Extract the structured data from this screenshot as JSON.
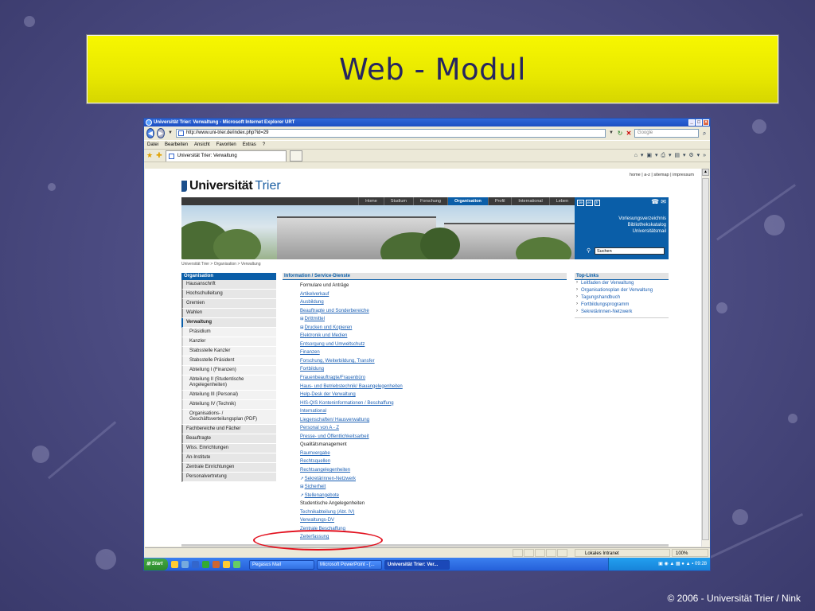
{
  "slide": {
    "title": "Web - Modul",
    "footer": "© 2006 - Universität Trier / Nink"
  },
  "window": {
    "title": "Universität Trier: Verwaltung - Microsoft Internet Explorer URT",
    "address": "http://www.uni-trier.de/index.php?id=29",
    "search_placeholder": "Google",
    "menu": [
      "Datei",
      "Bearbeiten",
      "Ansicht",
      "Favoriten",
      "Extras",
      "?"
    ],
    "tab_title": "Universität Trier: Verwaltung",
    "status_zone": "Lokales Intranet",
    "zoom": "100%"
  },
  "page": {
    "top_links": "home | a-z | sitemap | impressum",
    "logo_bold": "Universität",
    "logo_light": "Trier",
    "nav": [
      "Home",
      "Studium",
      "Forschung",
      "Organisation",
      "Profil",
      "International",
      "Leben"
    ],
    "nav_active": "Organisation",
    "lang": [
      "de",
      "en",
      "fr"
    ],
    "blue_links": [
      "Vorlesungsverzeichnis",
      "Bibliothekskatalog",
      "Universitätsmail"
    ],
    "search_value": "Suchen",
    "breadcrumb": "Universität Trier > Organisation > Verwaltung",
    "left_header": "Organisation",
    "left_nav": [
      {
        "label": "Hausanschrift",
        "kind": "top"
      },
      {
        "label": "Hochschulleitung",
        "kind": "top"
      },
      {
        "label": "Gremien",
        "kind": "top"
      },
      {
        "label": "Wahlen",
        "kind": "top"
      },
      {
        "label": "Verwaltung",
        "kind": "bold"
      },
      {
        "label": "Präsidium",
        "kind": "sub"
      },
      {
        "label": "Kanzler",
        "kind": "sub"
      },
      {
        "label": "Stabsstelle Kanzler",
        "kind": "sub"
      },
      {
        "label": "Stabsstelle Präsident",
        "kind": "sub"
      },
      {
        "label": "Abteilung I (Finanzen)",
        "kind": "sub"
      },
      {
        "label": "Abteilung II (Studentische Angelegenheiten)",
        "kind": "sub"
      },
      {
        "label": "Abteilung III (Personal)",
        "kind": "sub"
      },
      {
        "label": "Abteilung IV (Technik)",
        "kind": "sub"
      },
      {
        "label": "Organisations- / Geschäftsverteilungsplan (PDF)",
        "kind": "sub"
      },
      {
        "label": "Fachbereiche und Fächer",
        "kind": "top"
      },
      {
        "label": "Beauftragte",
        "kind": "top"
      },
      {
        "label": "Wiss. Einrichtungen",
        "kind": "top"
      },
      {
        "label": "An-Institute",
        "kind": "top"
      },
      {
        "label": "Zentrale Einrichtungen",
        "kind": "top"
      },
      {
        "label": "Personalvertretung",
        "kind": "top"
      }
    ],
    "main_header": "Information / Service-Dienste",
    "main_items": [
      {
        "label": "Formulare und Anträge",
        "kind": "plain"
      },
      {
        "label": "Artikelverkauf",
        "kind": "link"
      },
      {
        "label": "Ausbildung",
        "kind": "link"
      },
      {
        "label": "Beauftragte und Sonderbereiche",
        "kind": "link"
      },
      {
        "label": "Drittmittel",
        "kind": "link",
        "prefix": "⊞"
      },
      {
        "label": "Drucken und Kopieren",
        "kind": "link",
        "prefix": "⊞"
      },
      {
        "label": "Elektronik und Medien",
        "kind": "link"
      },
      {
        "label": "Entsorgung und Umweltschutz",
        "kind": "link"
      },
      {
        "label": "Finanzen",
        "kind": "link"
      },
      {
        "label": "Forschung, Weiterbildung, Transfer",
        "kind": "link"
      },
      {
        "label": "Fortbildung",
        "kind": "link"
      },
      {
        "label": "Frauenbeauftragte/Frauenbüro",
        "kind": "link"
      },
      {
        "label": "Haus- und Betriebstechnik/ Bauangelegenheiten",
        "kind": "link"
      },
      {
        "label": "Help-Desk der Verwaltung",
        "kind": "link"
      },
      {
        "label": "HIS-QIS Konteninformationen / Beschaffung",
        "kind": "link"
      },
      {
        "label": "International",
        "kind": "link"
      },
      {
        "label": "Liegenschaften/ Hausverwaltung",
        "kind": "link"
      },
      {
        "label": "Personal von A - Z",
        "kind": "link"
      },
      {
        "label": "Presse- und Öffentlichkeitsarbeit",
        "kind": "link"
      },
      {
        "label": "Qualitätsmanagement",
        "kind": "plain"
      },
      {
        "label": "Raumvergabe",
        "kind": "link"
      },
      {
        "label": "Rechtsquellen",
        "kind": "link"
      },
      {
        "label": "Rechtsangelegenheiten",
        "kind": "link"
      },
      {
        "label": "Sekretärinnen-Netzwerk",
        "kind": "link",
        "prefix": "↗"
      },
      {
        "label": "Sicherheit",
        "kind": "link",
        "prefix": "⊞"
      },
      {
        "label": "Stellenangebote",
        "kind": "link",
        "prefix": "↗"
      },
      {
        "label": "Studentische Angelegenheiten",
        "kind": "plain"
      },
      {
        "label": "Technikabteilung (Abt. IV)",
        "kind": "link"
      },
      {
        "label": "Verwaltungs-DV",
        "kind": "link"
      },
      {
        "label": "Zentrale Beschaffung",
        "kind": "link"
      },
      {
        "label": "Zeiterfassung",
        "kind": "link"
      }
    ],
    "right_header": "Top-Links",
    "right_links": [
      "Leitfaden der Verwaltung",
      "Organisationsplan der Verwaltung",
      "Tagungshandbuch",
      "Fortbildungsprogramm",
      "Sekretärinnen-Netzwerk"
    ]
  },
  "taskbar": {
    "start": "Start",
    "tasks": [
      "Pegasus Mail",
      "Microsoft PowerPoint - [...",
      "Universität Trier: Ver..."
    ],
    "clock": "09:28"
  }
}
